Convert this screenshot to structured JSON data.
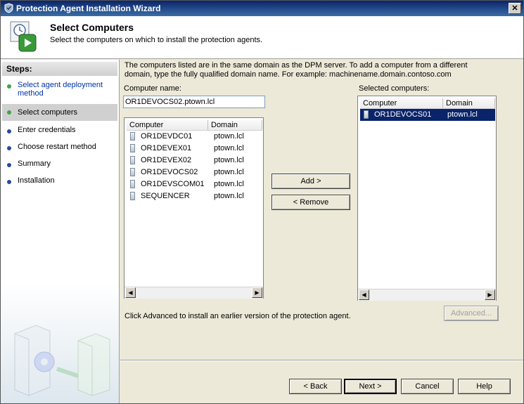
{
  "window": {
    "title": "Protection Agent Installation Wizard",
    "close_label": "✕"
  },
  "header": {
    "title": "Select Computers",
    "subtitle": "Select the computers on which to install the protection agents."
  },
  "sidebar": {
    "heading": "Steps:",
    "items": [
      {
        "label": "Select agent deployment method",
        "state": "done"
      },
      {
        "label": "Select computers",
        "state": "current"
      },
      {
        "label": "Enter credentials",
        "state": "pending"
      },
      {
        "label": "Choose restart method",
        "state": "pending"
      },
      {
        "label": "Summary",
        "state": "pending"
      },
      {
        "label": "Installation",
        "state": "pending"
      }
    ]
  },
  "main": {
    "description": "The computers listed are in the same domain as the DPM server. To add a computer from a different domain, type the fully qualified domain name. For example: machinename.domain.contoso.com",
    "computer_name_label": "Computer name:",
    "computer_name_value": "OR1DEVOCS02.ptown.lcl",
    "available": {
      "col_computer": "Computer",
      "col_domain": "Domain",
      "rows": [
        {
          "computer": "OR1DEVDC01",
          "domain": "ptown.lcl"
        },
        {
          "computer": "OR1DEVEX01",
          "domain": "ptown.lcl"
        },
        {
          "computer": "OR1DEVEX02",
          "domain": "ptown.lcl"
        },
        {
          "computer": "OR1DEVOCS02",
          "domain": "ptown.lcl"
        },
        {
          "computer": "OR1DEVSCOM01",
          "domain": "ptown.lcl"
        },
        {
          "computer": "SEQUENCER",
          "domain": "ptown.lcl"
        }
      ]
    },
    "selected_label": "Selected computers:",
    "selected": {
      "col_computer": "Computer",
      "col_domain": "Domain",
      "rows": [
        {
          "computer": "OR1DEVOCS01",
          "domain": "ptown.lcl"
        }
      ]
    },
    "add_label": "Add >",
    "remove_label": "< Remove",
    "advanced_note": "Click Advanced to install an earlier version of the protection agent.",
    "advanced_label": "Advanced..."
  },
  "footer": {
    "back": "< Back",
    "next": "Next >",
    "cancel": "Cancel",
    "help": "Help"
  },
  "icons": {
    "app": "shield-icon",
    "header": "computer-play-icon",
    "art": "servers-gear-icon"
  },
  "colors": {
    "title_bar": "#0a246a",
    "selection": "#0a246a",
    "step_dot": "#3aa84a"
  }
}
